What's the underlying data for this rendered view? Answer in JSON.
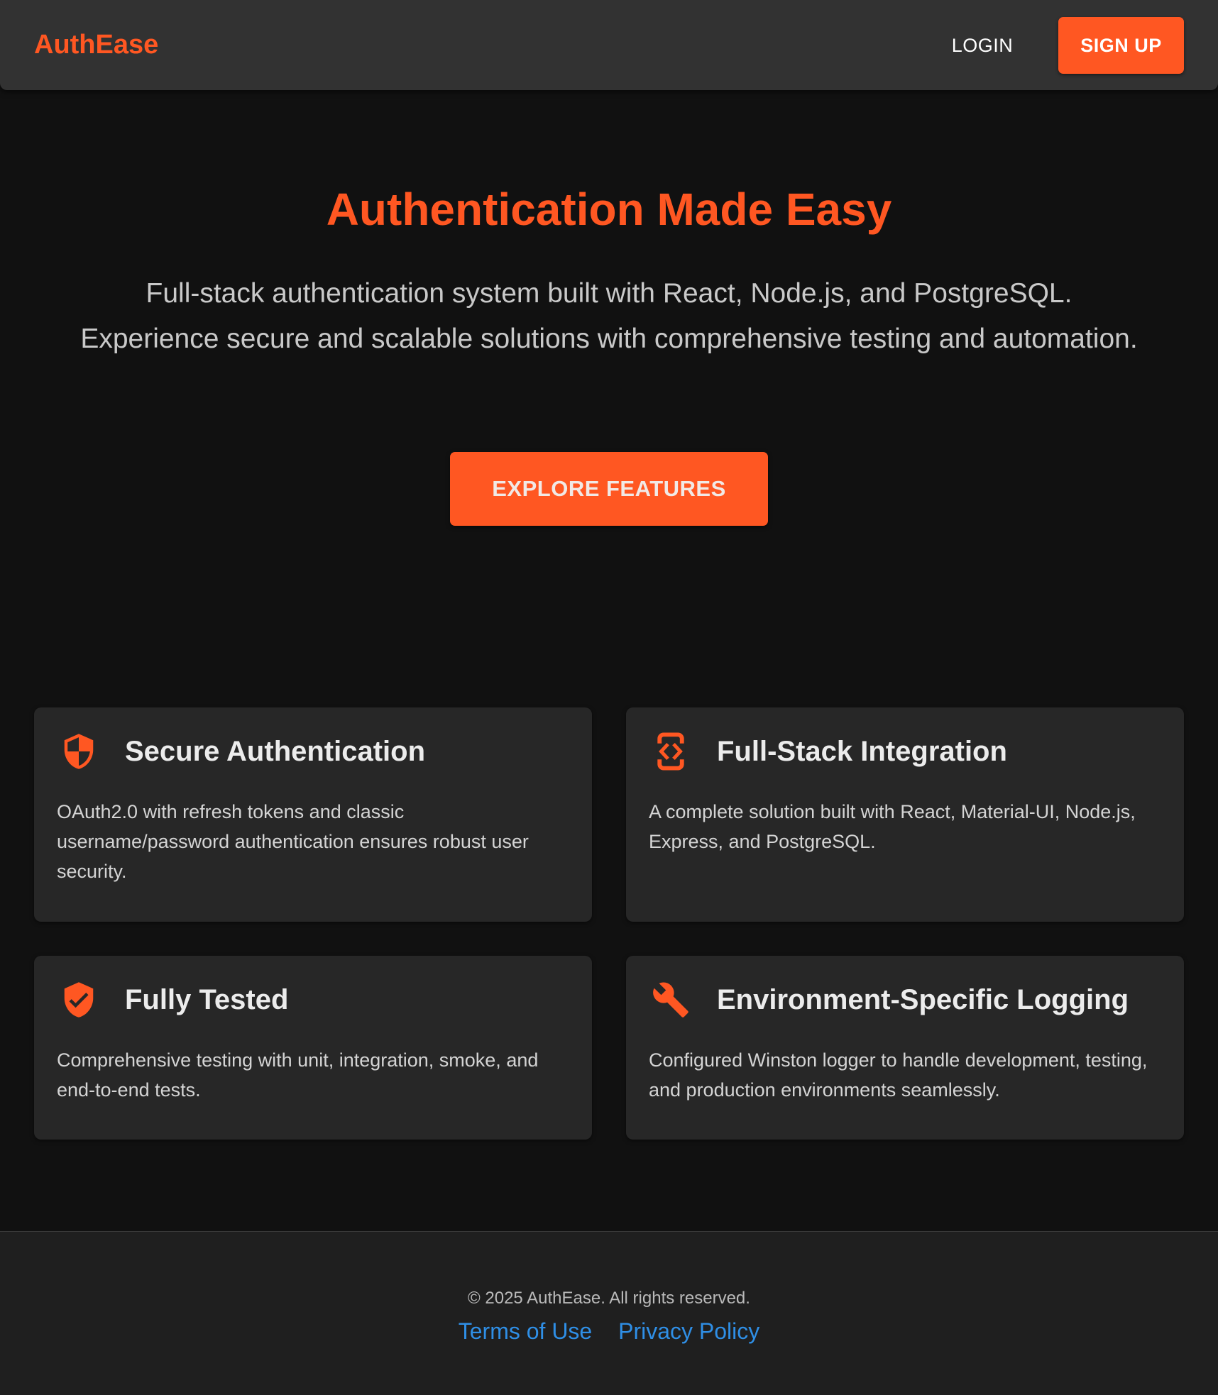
{
  "header": {
    "brand": "AuthEase",
    "login_label": "LOGIN",
    "signup_label": "SIGN UP"
  },
  "hero": {
    "title": "Authentication Made Easy",
    "subtitle": "Full-stack authentication system built with React, Node.js, and PostgreSQL. Experience secure and scalable solutions with comprehensive testing and automation.",
    "cta_label": "EXPLORE FEATURES"
  },
  "features": [
    {
      "icon": "shield-icon",
      "title": "Secure Authentication",
      "description": "OAuth2.0 with refresh tokens and classic username/password authentication ensures robust user security."
    },
    {
      "icon": "code-bracket-icon",
      "title": "Full-Stack Integration",
      "description": "A complete solution built with React, Material-UI, Node.js, Express, and PostgreSQL."
    },
    {
      "icon": "verified-shield-icon",
      "title": "Fully Tested",
      "description": "Comprehensive testing with unit, integration, smoke, and end-to-end tests."
    },
    {
      "icon": "wrench-icon",
      "title": "Environment-Specific Logging",
      "description": "Configured Winston logger to handle development, testing, and production environments seamlessly."
    }
  ],
  "footer": {
    "copyright": "© 2025 AuthEase. All rights reserved.",
    "links": [
      "Terms of Use",
      "Privacy Policy"
    ]
  },
  "colors": {
    "accent": "#ff5722",
    "background": "#111111",
    "header": "#323232",
    "card": "#272727",
    "link": "#2f8fe6"
  }
}
